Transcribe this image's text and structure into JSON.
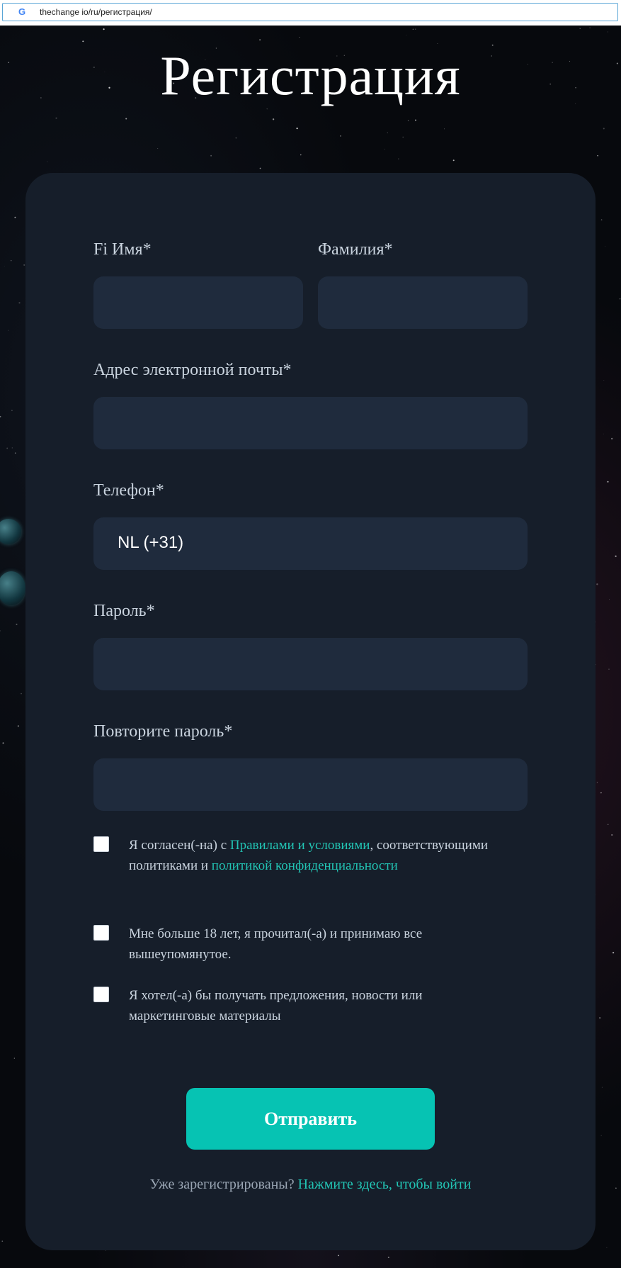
{
  "browser": {
    "url": "thechange io/ru/регистрация/",
    "favicon_letter": "G"
  },
  "page": {
    "title": "Регистрация"
  },
  "form": {
    "first_name": {
      "label": "Fi Имя*",
      "value": ""
    },
    "last_name": {
      "label": "Фамилия*",
      "value": ""
    },
    "email": {
      "label": "Адрес электронной почты*",
      "value": ""
    },
    "phone": {
      "label": "Телефон*",
      "value": "NL (+31)"
    },
    "password": {
      "label": "Пароль*",
      "value": ""
    },
    "password_repeat": {
      "label": "Повторите пароль*",
      "value": ""
    },
    "checkboxes": [
      {
        "checked": false,
        "text_before": "Я согласен(-на) с ",
        "link1": "Правилами и условиями",
        "text_middle": ", соответствующими политиками и ",
        "link2": "политикой конфиденциальности"
      },
      {
        "checked": false,
        "text": "Мне больше 18 лет, я прочитал(-а) и принимаю все вышеупомянутое."
      },
      {
        "checked": false,
        "text": "Я хотел(-а) бы получать предложения, новости или маркетинговые материалы"
      }
    ],
    "submit_label": "Отправить"
  },
  "footer": {
    "text": "Уже зарегистрированы? ",
    "link": "Нажмите здесь, чтобы войти"
  },
  "colors": {
    "accent": "#06c3b3",
    "link": "#22c4b4",
    "card": "#161e2a",
    "field": "#1f2b3d"
  }
}
